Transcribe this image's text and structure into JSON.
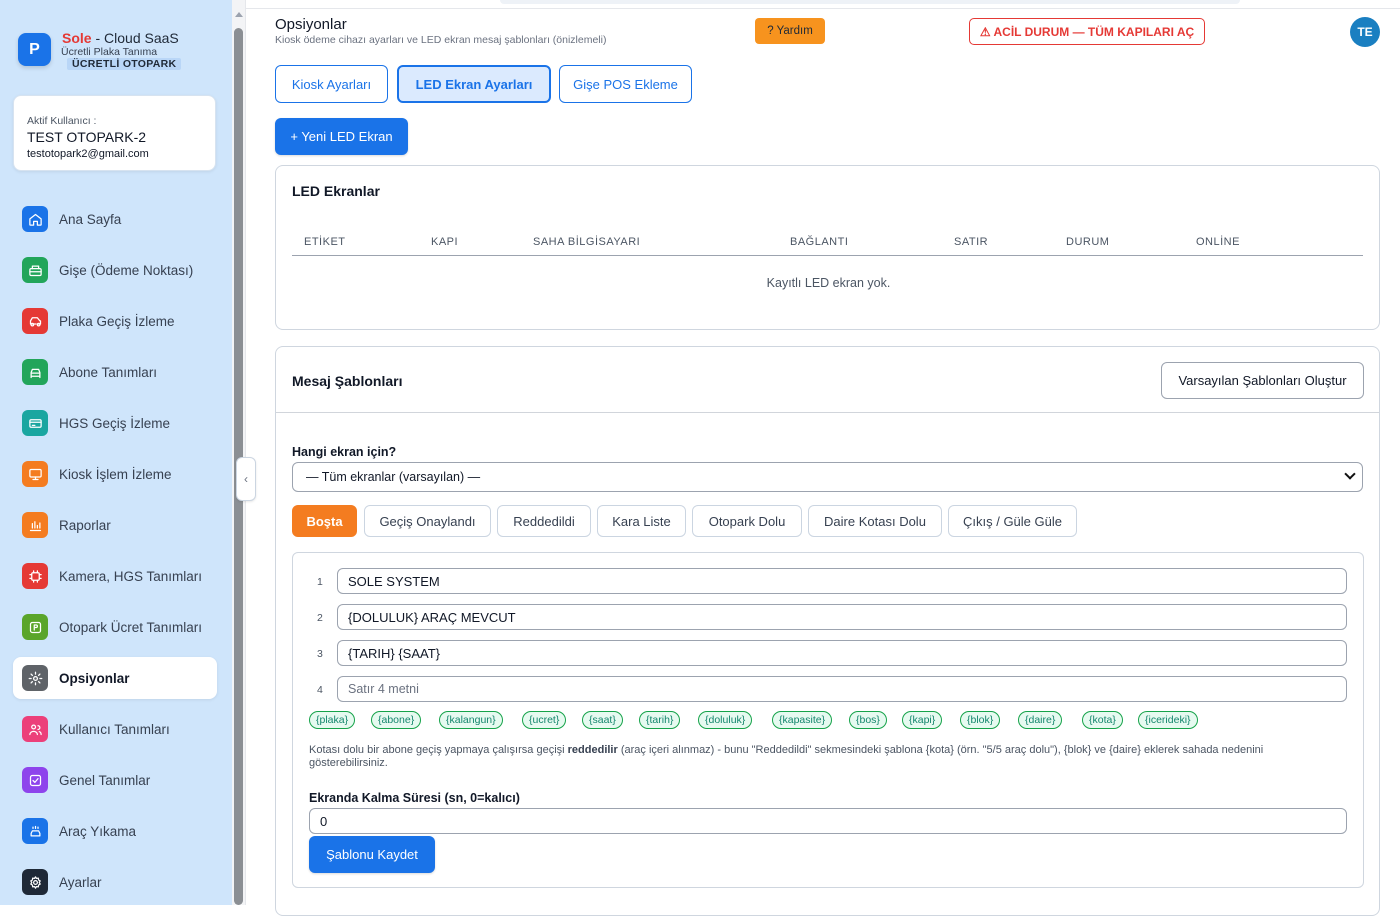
{
  "brand": {
    "logo_letter": "P",
    "name": "Sole",
    "name_suffix": " - Cloud SaaS",
    "subtitle": "Ücretli Plaka Tanıma",
    "badge": "ÜCRETLİ OTOPARK"
  },
  "user": {
    "label": "Aktif Kullanıcı :",
    "name": "TEST OTOPARK-2",
    "email": "testotopark2@gmail.com"
  },
  "sidebar": {
    "items": [
      {
        "label": "Ana Sayfa",
        "icon": "home-icon",
        "color": "#1a73e8"
      },
      {
        "label": "Gişe (Ödeme Noktası)",
        "icon": "cash-register-icon",
        "color": "#22a55a"
      },
      {
        "label": "Plaka Geçiş İzleme",
        "icon": "car-icon",
        "color": "#e53935"
      },
      {
        "label": "Abone Tanımları",
        "icon": "subscriber-car-icon",
        "color": "#22a55a"
      },
      {
        "label": "HGS Geçiş İzleme",
        "icon": "card-icon",
        "color": "#1aa6a0"
      },
      {
        "label": "Kiosk İşlem İzleme",
        "icon": "monitor-icon",
        "color": "#f47c20"
      },
      {
        "label": "Raporlar",
        "icon": "bar-chart-icon",
        "color": "#f47c20"
      },
      {
        "label": "Kamera, HGS Tanımları",
        "icon": "chip-icon",
        "color": "#e53935"
      },
      {
        "label": "Otopark Ücret Tanımları",
        "icon": "parking-icon",
        "color": "#5aa52a"
      },
      {
        "label": "Opsiyonlar",
        "icon": "gear-icon",
        "color": "#5f6368",
        "active": true
      },
      {
        "label": "Kullanıcı Tanımları",
        "icon": "users-icon",
        "color": "#ec407a"
      },
      {
        "label": "Genel Tanımlar",
        "icon": "checkbox-icon",
        "color": "#8e44ec"
      },
      {
        "label": "Araç Yıkama",
        "icon": "car-wash-icon",
        "color": "#1a73e8"
      },
      {
        "label": "Ayarlar",
        "icon": "settings-icon",
        "color": "#1f2937"
      }
    ]
  },
  "header": {
    "title": "Opsiyonlar",
    "subtitle": "Kiosk ödeme cihazı ayarları ve LED ekran mesaj şablonları (önizlemeli)",
    "help_label": "? Yardım",
    "emergency_label": "⚠ ACİL DURUM — TÜM KAPILARI AÇ",
    "avatar_initials": "TE"
  },
  "tabs": [
    {
      "label": "Kiosk Ayarları",
      "active": false
    },
    {
      "label": "LED Ekran Ayarları",
      "active": true
    },
    {
      "label": "Gişe POS Ekleme",
      "active": false
    }
  ],
  "new_led_button": "+ Yeni LED Ekran",
  "led_card": {
    "title": "LED Ekranlar",
    "columns": [
      "ETİKET",
      "KAPI",
      "SAHA BİLGİSAYARI",
      "BAĞLANTI",
      "SATIR",
      "DURUM",
      "ONLİNE"
    ],
    "empty_text": "Kayıtlı LED ekran yok."
  },
  "templates_card": {
    "title": "Mesaj Şablonları",
    "create_defaults_button": "Varsayılan Şablonları Oluştur",
    "screen_label": "Hangi ekran için?",
    "screen_select_value": "— Tüm ekranlar (varsayılan) —",
    "template_tabs": [
      {
        "label": "Boşta",
        "active": true
      },
      {
        "label": "Geçiş Onaylandı"
      },
      {
        "label": "Reddedildi"
      },
      {
        "label": "Kara Liste"
      },
      {
        "label": "Otopark Dolu"
      },
      {
        "label": "Daire Kotası Dolu"
      },
      {
        "label": "Çıkış / Güle Güle"
      }
    ],
    "lines": [
      {
        "num": "1",
        "value": "SOLE SYSTEM",
        "placeholder": ""
      },
      {
        "num": "2",
        "value": "{DOLULUK} ARAÇ MEVCUT",
        "placeholder": ""
      },
      {
        "num": "3",
        "value": "{TARIH} {SAAT}",
        "placeholder": ""
      },
      {
        "num": "4",
        "value": "",
        "placeholder": "Satır 4 metni"
      }
    ],
    "variables": [
      "{plaka}",
      "{abone}",
      "{kalangun}",
      "{ucret}",
      "{saat}",
      "{tarih}",
      "{doluluk}",
      "{kapasite}",
      "{bos}",
      "{kapi}",
      "{blok}",
      "{daire}",
      "{kota}",
      "{icerideki}"
    ],
    "note_part1": "Kotası dolu bir abone geçiş yapmaya çalışırsa geçişi ",
    "note_bold": "reddedilir",
    "note_part2": " (araç içeri alınmaz) - bunu \"Reddedildi\" sekmesindeki şablona {kota} (örn. \"5/5 araç dolu\"), {blok} ve {daire} eklerek sahada nedenini gösterebilirsiniz.",
    "duration_label": "Ekranda Kalma Süresi (sn, 0=kalıcı)",
    "duration_value": "0",
    "save_button": "Şablonu Kaydet"
  },
  "colors": {
    "primary": "#1a73e8",
    "accent_orange": "#f47c20",
    "danger": "#e53935",
    "sidebar_bg": "#cfe5fb",
    "chip_green": "#16a34a"
  }
}
